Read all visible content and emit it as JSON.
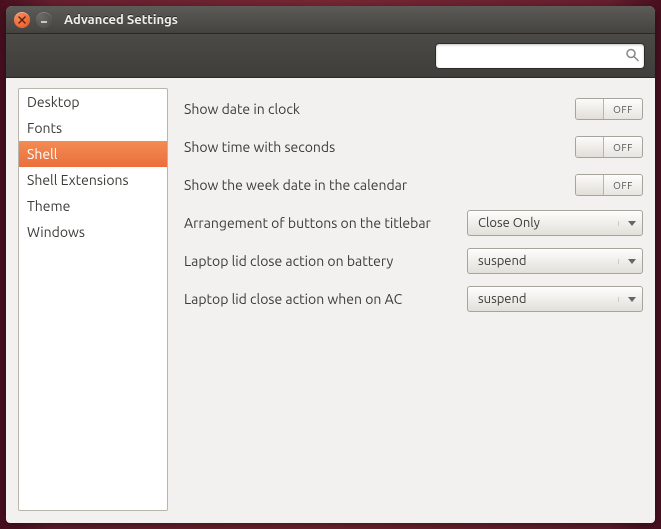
{
  "window": {
    "title": "Advanced Settings"
  },
  "search": {
    "value": "",
    "placeholder": ""
  },
  "sidebar": {
    "items": [
      {
        "label": "Desktop",
        "selected": false
      },
      {
        "label": "Fonts",
        "selected": false
      },
      {
        "label": "Shell",
        "selected": true
      },
      {
        "label": "Shell Extensions",
        "selected": false
      },
      {
        "label": "Theme",
        "selected": false
      },
      {
        "label": "Windows",
        "selected": false
      }
    ]
  },
  "settings": {
    "show_date_in_clock": {
      "label": "Show date in clock",
      "state": "OFF"
    },
    "show_time_with_seconds": {
      "label": "Show time with seconds",
      "state": "OFF"
    },
    "show_week_in_calendar": {
      "label": "Show the week date in the calendar",
      "state": "OFF"
    },
    "button_arrangement": {
      "label": "Arrangement of buttons on the titlebar",
      "value": "Close Only"
    },
    "lid_close_battery": {
      "label": "Laptop lid close action on battery",
      "value": "suspend"
    },
    "lid_close_ac": {
      "label": "Laptop lid close action when on AC",
      "value": "suspend"
    }
  }
}
